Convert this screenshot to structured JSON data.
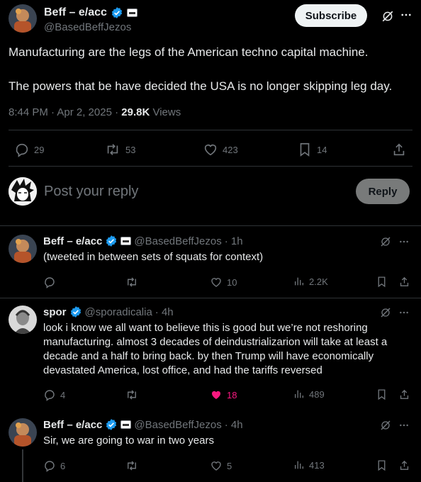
{
  "main_tweet": {
    "author_name": "Beff – e/acc",
    "handle": "@BasedBeffJezos",
    "subscribe_label": "Subscribe",
    "paragraphs": [
      "Manufacturing are the legs of the American techno capital machine.",
      "The powers that be have decided the USA is no longer skipping leg day."
    ],
    "time": "8:44 PM · Apr 2, 2025 · ",
    "views_count": "29.8K",
    "views_label": " Views",
    "stats": {
      "replies": "29",
      "reposts": "53",
      "likes": "423",
      "bookmarks": "14"
    }
  },
  "reply_box": {
    "placeholder": "Post your reply",
    "button_label": "Reply"
  },
  "replies": [
    {
      "author_name": "Beff – e/acc",
      "handle": "@BasedBeffJezos",
      "time": "· 1h",
      "text": "(tweeted in between sets of squats for context)",
      "replies": "",
      "reposts": "",
      "likes": "10",
      "views": "2.2K"
    },
    {
      "author_name": "spor",
      "handle": "@sporadicalia",
      "time": "· 4h",
      "text": "look i know we all want to believe this is good but we’re not reshoring manufacturing. almost 3 decades of deindustrializarion will take at least a decade and a half to bring back. by then Trump will have economically devastated America, lost office, and had the tariffs reversed",
      "replies": "4",
      "reposts": "",
      "likes": "18",
      "views": "489"
    },
    {
      "author_name": "Beff – e/acc",
      "handle": "@BasedBeffJezos",
      "time": "· 4h",
      "text": "Sir, we are going to war in two years",
      "replies": "6",
      "reposts": "",
      "likes": "5",
      "views": "413"
    }
  ],
  "colors": {
    "background": "#000000",
    "text": "#e7e9ea",
    "secondary": "#71767b",
    "verified": "#1d9bf0",
    "liked": "#f91880",
    "divider": "#2f3336"
  }
}
